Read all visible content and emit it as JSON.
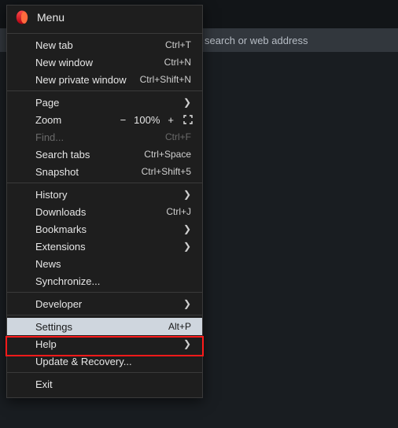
{
  "address_bar": {
    "placeholder_tail": "search or web address"
  },
  "menu": {
    "title": "Menu",
    "items": {
      "new_tab": {
        "label": "New tab",
        "shortcut": "Ctrl+T"
      },
      "new_window": {
        "label": "New window",
        "shortcut": "Ctrl+N"
      },
      "new_priv": {
        "label": "New private window",
        "shortcut": "Ctrl+Shift+N"
      },
      "page": {
        "label": "Page"
      },
      "zoom": {
        "label": "Zoom",
        "minus": "−",
        "value": "100%",
        "plus": "+"
      },
      "find": {
        "label": "Find...",
        "shortcut": "Ctrl+F"
      },
      "search_tabs": {
        "label": "Search tabs",
        "shortcut": "Ctrl+Space"
      },
      "snapshot": {
        "label": "Snapshot",
        "shortcut": "Ctrl+Shift+5"
      },
      "history": {
        "label": "History"
      },
      "downloads": {
        "label": "Downloads",
        "shortcut": "Ctrl+J"
      },
      "bookmarks": {
        "label": "Bookmarks"
      },
      "extensions": {
        "label": "Extensions"
      },
      "news": {
        "label": "News"
      },
      "synchronize": {
        "label": "Synchronize..."
      },
      "developer": {
        "label": "Developer"
      },
      "settings": {
        "label": "Settings",
        "shortcut": "Alt+P"
      },
      "help": {
        "label": "Help"
      },
      "update": {
        "label": "Update & Recovery..."
      },
      "exit": {
        "label": "Exit"
      }
    }
  }
}
